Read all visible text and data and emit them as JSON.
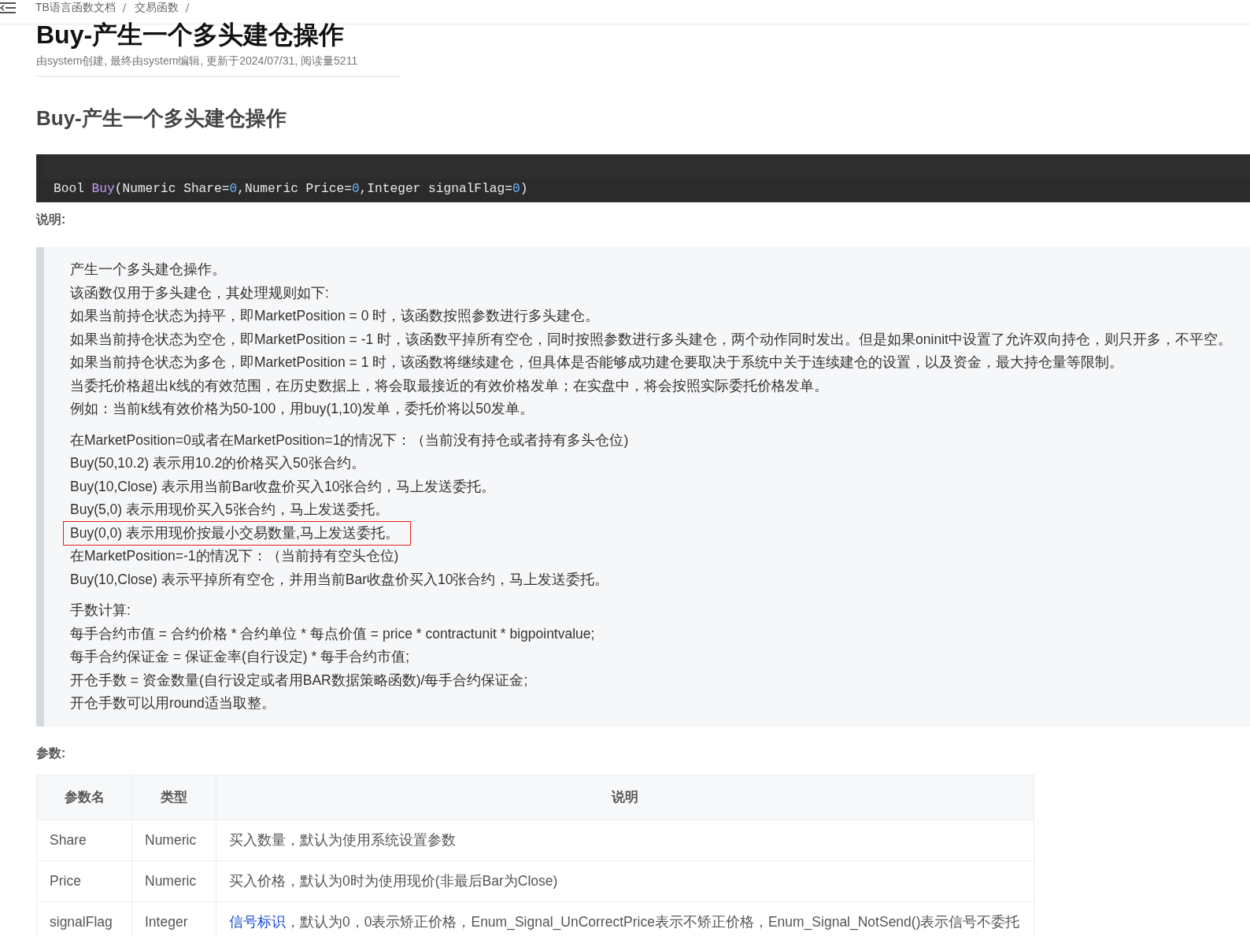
{
  "breadcrumb": [
    "TB语言函数文档",
    "交易函数"
  ],
  "title": "Buy-产生一个多头建仓操作",
  "meta": "由system创建, 最终由system编辑, 更新于2024/07/31, 阅读量5211",
  "heading": "Buy-产生一个多头建仓操作",
  "code": [
    {
      "kind": "plain",
      "text": "Bool "
    },
    {
      "kind": "function",
      "text": "Buy"
    },
    {
      "kind": "plain",
      "text": "(Numeric Share="
    },
    {
      "kind": "number",
      "text": "0"
    },
    {
      "kind": "plain",
      "text": ",Numeric Price="
    },
    {
      "kind": "number",
      "text": "0"
    },
    {
      "kind": "plain",
      "text": ",Integer signalFlag="
    },
    {
      "kind": "number",
      "text": "0"
    },
    {
      "kind": "plain",
      "text": ")"
    }
  ],
  "description_label": "说明:",
  "description": [
    [
      {
        "text": "产生一个多头建仓操作。",
        "highlighted": false
      },
      {
        "text": "该函数仅用于多头建仓，其处理规则如下:",
        "highlighted": false
      },
      {
        "text": "如果当前持仓状态为持平，即MarketPosition = 0 时，该函数按照参数进行多头建仓。",
        "highlighted": false
      },
      {
        "text": "如果当前持仓状态为空仓，即MarketPosition = -1 时，该函数平掉所有空仓，同时按照参数进行多头建仓，两个动作同时发出。但是如果oninit中设置了允许双向持仓，则只开多，不平空。",
        "highlighted": false
      },
      {
        "text": "如果当前持仓状态为多仓，即MarketPosition = 1 时，该函数将继续建仓，但具体是否能够成功建仓要取决于系统中关于连续建仓的设置，以及资金，最大持仓量等限制。",
        "highlighted": false
      },
      {
        "text": "当委托价格超出k线的有效范围，在历史数据上，将会取最接近的有效价格发单；在实盘中，将会按照实际委托价格发单。",
        "highlighted": false
      },
      {
        "text": "例如：当前k线有效价格为50-100，用buy(1,10)发单，委托价将以50发单。",
        "highlighted": false
      }
    ],
    [
      {
        "text": "在MarketPosition=0或者在MarketPosition=1的情况下：（当前没有持仓或者持有多头仓位)",
        "highlighted": false
      },
      {
        "text": "Buy(50,10.2) 表示用10.2的价格买入50张合约。",
        "highlighted": false
      },
      {
        "text": "Buy(10,Close) 表示用当前Bar收盘价买入10张合约，马上发送委托。",
        "highlighted": false
      },
      {
        "text": "Buy(5,0) 表示用现价买入5张合约，马上发送委托。",
        "highlighted": false
      },
      {
        "text": "Buy(0,0) 表示用现价按最小交易数量,马上发送委托。",
        "highlighted": true
      },
      {
        "text": "在MarketPosition=-1的情况下：（当前持有空头仓位)",
        "highlighted": false
      },
      {
        "text": "Buy(10,Close) 表示平掉所有空仓，并用当前Bar收盘价买入10张合约，马上发送委托。",
        "highlighted": false
      }
    ],
    [
      {
        "text": "手数计算:",
        "highlighted": false
      },
      {
        "text": "每手合约市值 = 合约价格 * 合约单位 * 每点价值 = price * contractunit * bigpointvalue;",
        "highlighted": false
      },
      {
        "text": "每手合约保证金 = 保证金率(自行设定) * 每手合约市值;",
        "highlighted": false
      },
      {
        "text": "开仓手数 = 资金数量(自行设定或者用BAR数据策略函数)/每手合约保证金;",
        "highlighted": false
      },
      {
        "text": "开仓手数可以用round适当取整。",
        "highlighted": false
      }
    ]
  ],
  "params_label": "参数:",
  "table": {
    "columns": [
      "参数名",
      "类型",
      "说明"
    ],
    "rows": [
      {
        "name": "Share",
        "type": "Numeric",
        "description": "买入数量，默认为使用系统设置参数"
      },
      {
        "name": "Price",
        "type": "Numeric",
        "description": "买入价格，默认为0时为使用现价(非最后Bar为Close)"
      },
      {
        "name": "signalFlag",
        "type": "Integer",
        "link": "信号标识",
        "description": "，默认为0，0表示矫正价格，Enum_Signal_UnCorrectPrice表示不矫正价格，Enum_Signal_NotSend()表示信号不委托"
      }
    ]
  }
}
